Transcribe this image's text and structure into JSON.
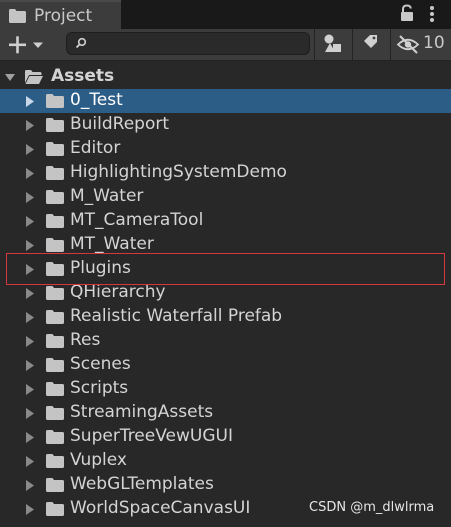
{
  "tab": {
    "title": "Project",
    "folder_icon": "folder-icon",
    "lock_icon": "lock-icon",
    "more_icon": "kebab-menu-icon"
  },
  "toolbar": {
    "create_icon": "plus-dropdown-icon",
    "search": {
      "placeholder": "",
      "value": ""
    },
    "filter_by_type_icon": "shapes-filter-icon",
    "filter_by_label_icon": "tag-icon",
    "hidden_packages_icon": "eye-slash-icon",
    "hidden_packages_count": "10"
  },
  "tree": {
    "root": {
      "label": "Assets",
      "expanded": true
    },
    "items": [
      {
        "label": "0_Test",
        "selected": true
      },
      {
        "label": "BuildReport",
        "selected": false
      },
      {
        "label": "Editor",
        "selected": false
      },
      {
        "label": "HighlightingSystemDemo",
        "selected": false
      },
      {
        "label": "M_Water",
        "selected": false
      },
      {
        "label": "MT_CameraTool",
        "selected": false
      },
      {
        "label": "MT_Water",
        "selected": false
      },
      {
        "label": "Plugins",
        "selected": false
      },
      {
        "label": "QHierarchy",
        "selected": false
      },
      {
        "label": "Realistic Waterfall Prefab",
        "selected": false
      },
      {
        "label": "Res",
        "selected": false
      },
      {
        "label": "Scenes",
        "selected": false
      },
      {
        "label": "Scripts",
        "selected": false
      },
      {
        "label": "StreamingAssets",
        "selected": false
      },
      {
        "label": "SuperTreeVewUGUI",
        "selected": false
      },
      {
        "label": "Vuplex",
        "selected": false
      },
      {
        "label": "WebGLTemplates",
        "selected": false
      },
      {
        "label": "WorldSpaceCanvasUI",
        "selected": false
      }
    ]
  },
  "colors": {
    "background": "#282828",
    "selection": "#2c5d87",
    "highlight_box": "#d0393e"
  },
  "watermark": "CSDN @m_dlwlrma"
}
